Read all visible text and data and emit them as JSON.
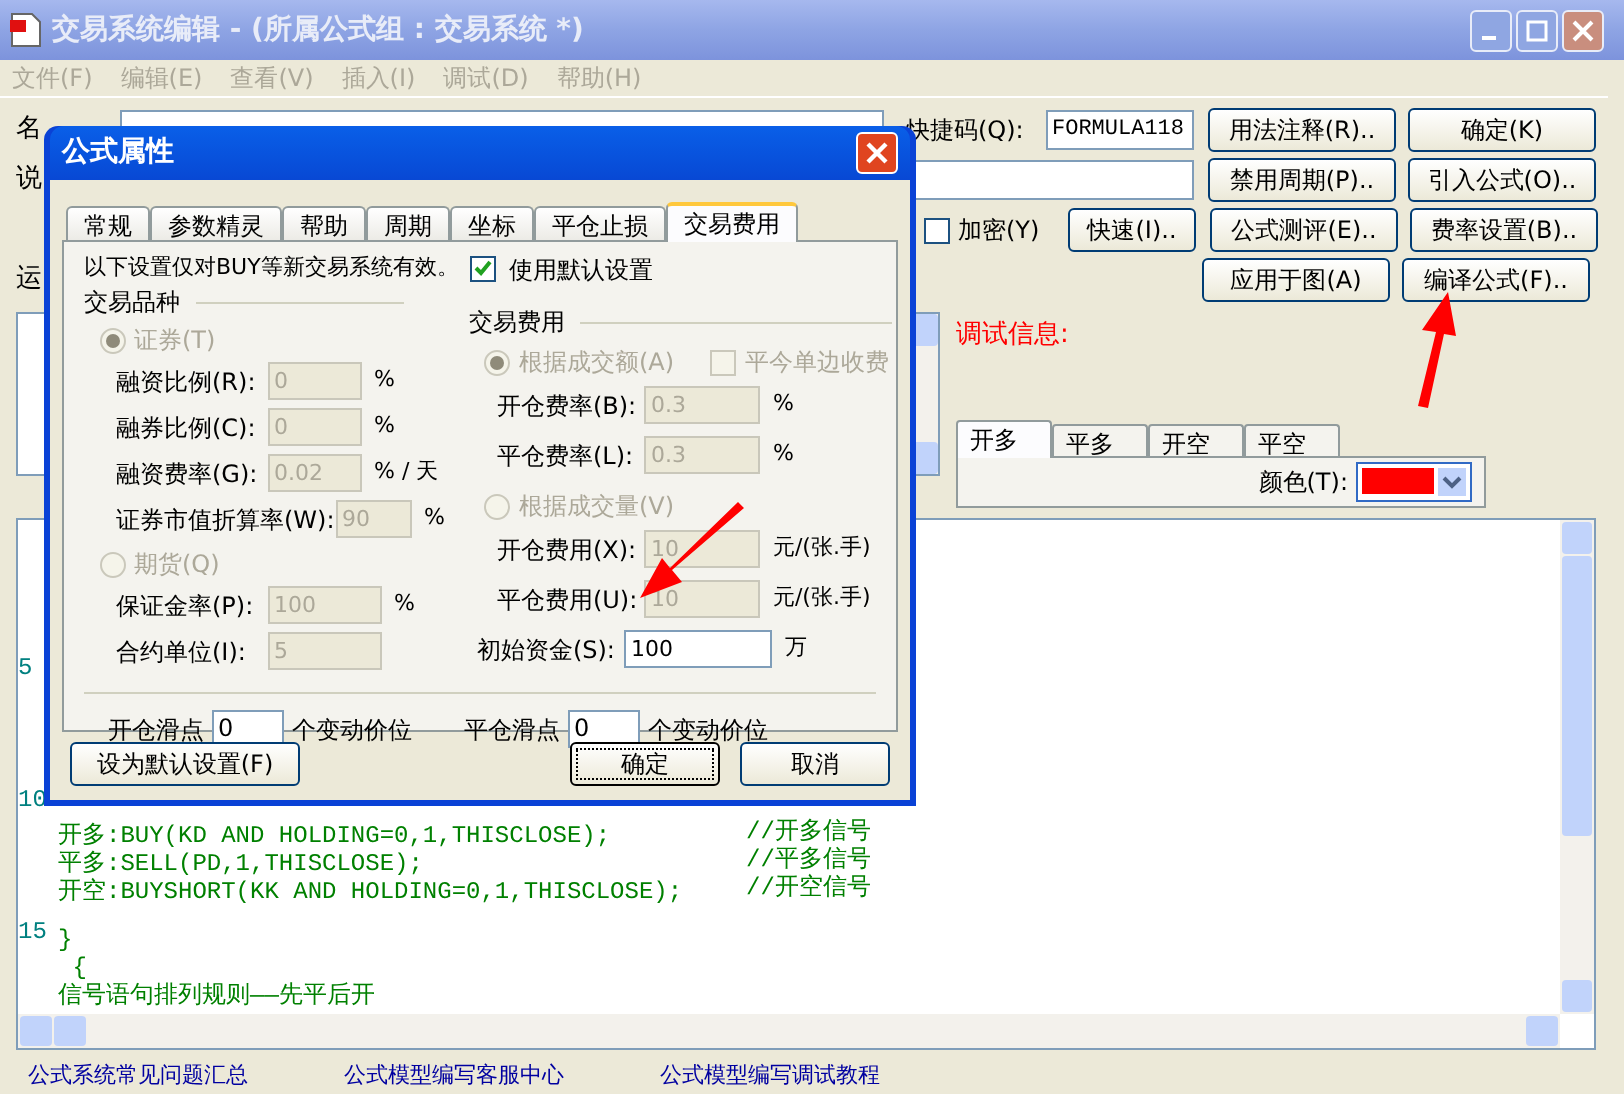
{
  "window": {
    "title": "交易系统编辑 - (所属公式组 : 交易系统 *)"
  },
  "menu": [
    "文件(F)",
    "编辑(E)",
    "查看(V)",
    "插入(I)",
    "调试(D)",
    "帮助(H)"
  ],
  "form": {
    "name_label": "名",
    "desc_label": "说",
    "run_label": "运",
    "shortcut": {
      "label": "快捷码(Q):",
      "value": "FORMULA118"
    },
    "encrypt": {
      "label": "加密(Y)",
      "checked": false
    },
    "quick_button": "快速(I)..",
    "buttons": [
      [
        "用法注释(R)..",
        "确定(K)"
      ],
      [
        "禁用周期(P)..",
        "引入公式(O).."
      ],
      [
        "公式测评(E)..",
        "费率设置(B).."
      ],
      [
        "应用于图(A)",
        "编译公式(F).."
      ]
    ]
  },
  "debug": {
    "label": "调试信息:",
    "tabs": [
      {
        "label": "开多",
        "selected": true
      },
      {
        "label": "平多",
        "selected": false
      },
      {
        "label": "开空",
        "selected": false
      },
      {
        "label": "平空",
        "selected": false
      }
    ],
    "color_label": "颜色(T):",
    "color": "#ff0000"
  },
  "editor": {
    "line_numbers": [
      "5",
      "10",
      "15"
    ],
    "blocks": [
      [
        {
          "code": "开多:BUY(KD AND HOLDING=0,1,THISCLOSE);",
          "comment": "//开多信号"
        },
        {
          "code": "平多:SELL(PD,1,THISCLOSE);",
          "comment": "//平多信号"
        },
        {
          "code": "开空:BUYSHORT(KK AND HOLDING=0,1,THISCLOSE);",
          "comment": "//开空信号"
        }
      ],
      [
        {
          "code": "}"
        },
        {
          "code": " {"
        },
        {
          "code": "信号语句排列规则——先平后开"
        }
      ]
    ]
  },
  "links": [
    "公式系统常见问题汇总",
    "公式模型编写客服中心",
    "公式模型编写调试教程"
  ],
  "dialog": {
    "title": "公式属性",
    "tabs": [
      {
        "label": "常规",
        "selected": false
      },
      {
        "label": "参数精灵",
        "selected": false
      },
      {
        "label": "帮助",
        "selected": false
      },
      {
        "label": "周期",
        "selected": false
      },
      {
        "label": "坐标",
        "selected": false
      },
      {
        "label": "平仓止损",
        "selected": false
      },
      {
        "label": "交易费用",
        "selected": true
      }
    ],
    "notice": "以下设置仅对BUY等新交易系统有效。",
    "use_default": {
      "label": "使用默认设置",
      "checked": true
    },
    "left_group": {
      "title": "交易品种",
      "options": [
        {
          "label": "证券(T)",
          "selected": true,
          "disabled": true,
          "fields": [
            {
              "label": "融资比例(R):",
              "value": "0",
              "unit": "%",
              "disabled": true
            },
            {
              "label": "融券比例(C):",
              "value": "0",
              "unit": "%",
              "disabled": true
            },
            {
              "label": "融资费率(G):",
              "value": "0.02",
              "unit": "% / 天",
              "disabled": true
            },
            {
              "label": "证券市值折算率(W):",
              "value": "90",
              "unit": "%",
              "disabled": true
            }
          ]
        },
        {
          "label": "期货(Q)",
          "selected": false,
          "disabled": true,
          "fields": [
            {
              "label": "保证金率(P):",
              "value": "100",
              "unit": "%",
              "disabled": true
            },
            {
              "label": "合约单位(I):",
              "value": "5",
              "disabled": true
            }
          ]
        }
      ]
    },
    "right_group": {
      "title": "交易费用",
      "single_side": {
        "label": "平今单边收费",
        "checked": false,
        "disabled": true
      },
      "options": [
        {
          "label": "根据成交额(A)",
          "selected": true,
          "disabled": true,
          "fields": [
            {
              "label": "开仓费率(B):",
              "value": "0.3",
              "unit": "%",
              "disabled": true
            },
            {
              "label": "平仓费率(L):",
              "value": "0.3",
              "unit": "%",
              "disabled": true
            }
          ]
        },
        {
          "label": "根据成交量(V)",
          "selected": false,
          "disabled": true,
          "fields": [
            {
              "label": "开仓费用(X):",
              "value": "10",
              "unit": "元/(张.手)",
              "disabled": true
            },
            {
              "label": "平仓费用(U):",
              "value": "10",
              "unit": "元/(张.手)",
              "disabled": true
            }
          ]
        }
      ],
      "initial_capital": {
        "label": "初始资金(S):",
        "value": "100",
        "unit": "万",
        "disabled": false
      }
    },
    "slippage": [
      {
        "label": "开仓滑点",
        "value": "0",
        "unit": "个变动价位"
      },
      {
        "label": "平仓滑点",
        "value": "0",
        "unit": "个变动价位"
      }
    ],
    "buttons": [
      {
        "label": "设为默认设置(F)",
        "kind": "secondary"
      },
      {
        "label": "确定",
        "kind": "default"
      },
      {
        "label": "取消",
        "kind": "secondary"
      }
    ]
  }
}
